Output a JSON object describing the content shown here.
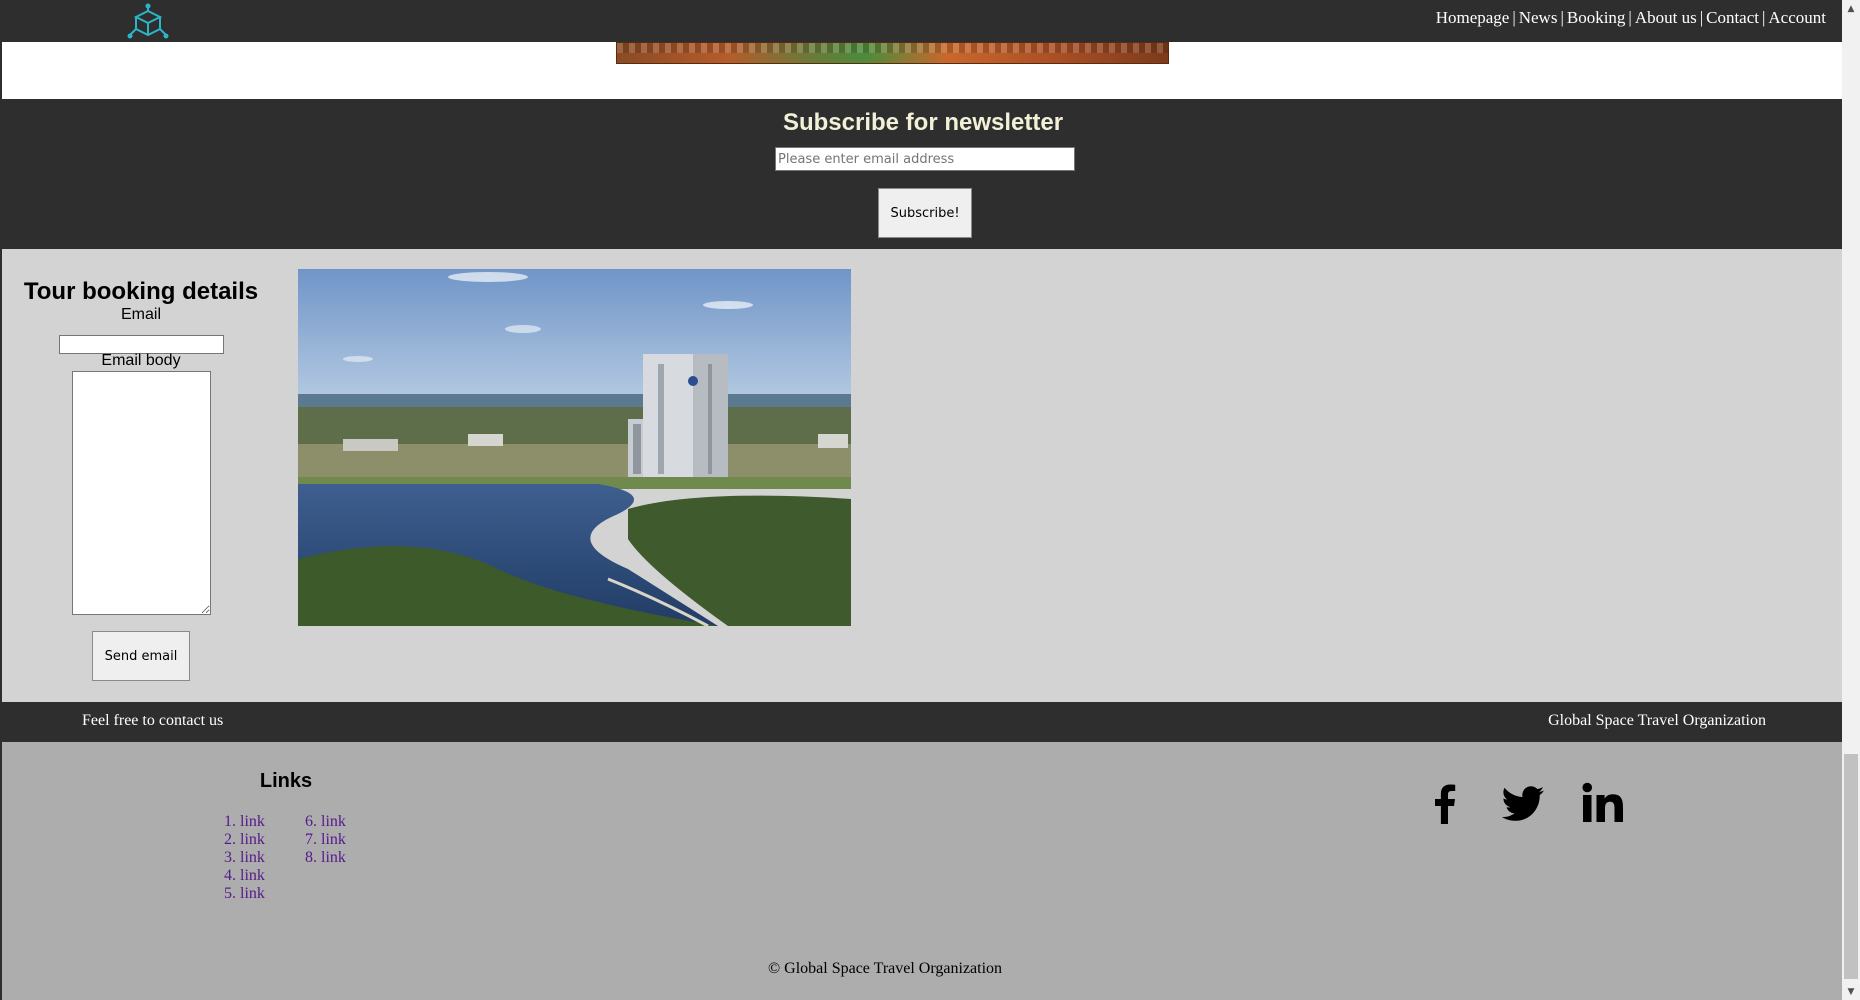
{
  "nav": {
    "items": [
      "Homepage",
      "News",
      "Booking",
      "About us",
      "Contact",
      "Account"
    ],
    "separator": "|"
  },
  "newsletter": {
    "title": "Subscribe for newsletter",
    "email_placeholder": "Please enter email address",
    "button_label": "Subscribe!"
  },
  "booking": {
    "title": "Tour booking details",
    "email_label": "Email",
    "body_label": "Email body",
    "send_label": "Send email"
  },
  "footer_bar": {
    "left_text": "Feel free to contact us",
    "right_text": "Global Space Travel Organization"
  },
  "footer": {
    "links_title": "Links",
    "links_col1": [
      "1. link",
      "2. link",
      "3. link",
      "4. link",
      "5. link"
    ],
    "links_col2": [
      "6. link",
      "7. link",
      "8. link"
    ],
    "social": [
      "facebook-icon",
      "twitter-icon",
      "linkedin-icon"
    ],
    "copyright": "© Global Space Travel Organization"
  },
  "colors": {
    "dark_bar": "#2e2e2e",
    "booking_bg": "#d3d3d3",
    "footer_bg": "#adadad",
    "logo_accent": "#2bb5c9",
    "link_color": "#551a8b",
    "newsletter_title": "#f3f0d8"
  }
}
